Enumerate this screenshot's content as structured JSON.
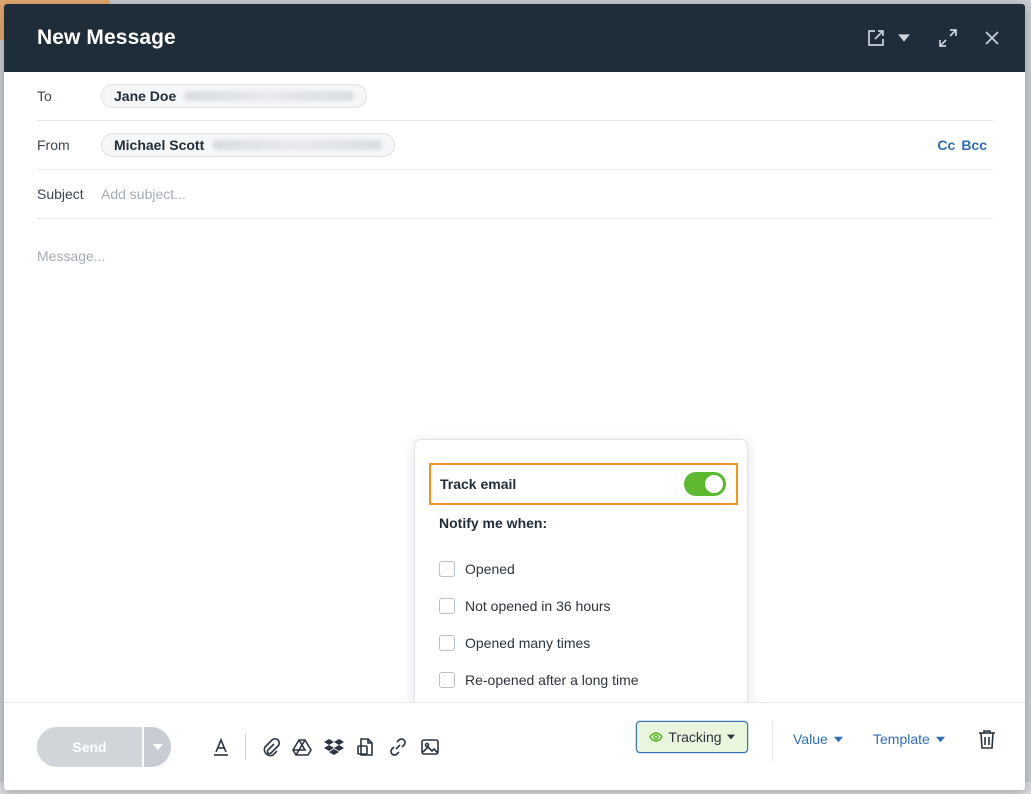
{
  "header": {
    "title": "New Message"
  },
  "fields": {
    "to_label": "To",
    "to_name": "Jane Doe",
    "from_label": "From",
    "from_name": "Michael Scott",
    "cc_label": "Cc",
    "bcc_label": "Bcc",
    "subject_label": "Subject",
    "subject_placeholder": "Add subject...",
    "message_placeholder": "Message..."
  },
  "tracking_popover": {
    "track_label": "Track email",
    "track_enabled": true,
    "notify_heading": "Notify me when:",
    "options": [
      "Opened",
      "Not opened in 36 hours",
      "Opened many times",
      "Re-opened after a long time"
    ]
  },
  "footer": {
    "send_label": "Send",
    "tracking_label": "Tracking",
    "value_label": "Value",
    "template_label": "Template"
  },
  "colors": {
    "header_bg": "#1f2d3b",
    "accent_blue": "#2f6db5",
    "toggle_green": "#5cb82e",
    "highlight_orange": "#f0931f"
  }
}
